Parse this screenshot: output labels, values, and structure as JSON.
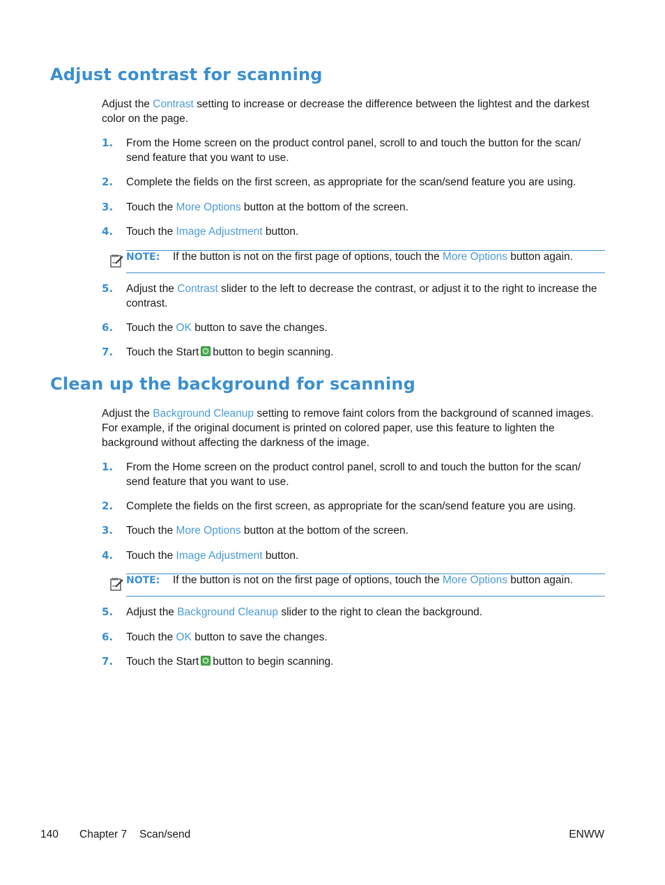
{
  "section1": {
    "title": "Adjust contrast for scanning",
    "intro": {
      "pre": "Adjust the ",
      "link": "Contrast",
      "post": " setting to increase or decrease the difference between the lightest and the darkest color on the page."
    },
    "steps": [
      {
        "num": "1.",
        "text": "From the Home screen on the product control panel, scroll to and touch the button for the scan/ send feature that you want to use."
      },
      {
        "num": "2.",
        "text": "Complete the fields on the first screen, as appropriate for the scan/send feature you are using."
      },
      {
        "num": "3.",
        "pre": "Touch the ",
        "link": "More Options",
        "post": " button at the bottom of the screen."
      },
      {
        "num": "4.",
        "pre": "Touch the ",
        "link": "Image Adjustment",
        "post": " button."
      },
      {
        "num": "5.",
        "pre": "Adjust the ",
        "link": "Contrast",
        "post": " slider to the left to decrease the contrast, or adjust it to the right to increase the contrast."
      },
      {
        "num": "6.",
        "pre": "Touch the ",
        "link": "OK",
        "post": " button to save the changes."
      },
      {
        "num": "7.",
        "pre": "Touch the Start",
        "post": "button to begin scanning."
      }
    ],
    "note": {
      "label": "NOTE:",
      "pre": "If the button is not on the first page of options, touch the ",
      "link": "More Options",
      "post": " button again."
    }
  },
  "section2": {
    "title": "Clean up the background for scanning",
    "intro": {
      "pre": "Adjust the ",
      "link": "Background Cleanup",
      "post": " setting to remove faint colors from the background of scanned images. For example, if the original document is printed on colored paper, use this feature to lighten the background without affecting the darkness of the image."
    },
    "steps": [
      {
        "num": "1.",
        "text": "From the Home screen on the product control panel, scroll to and touch the button for the scan/ send feature that you want to use."
      },
      {
        "num": "2.",
        "text": "Complete the fields on the first screen, as appropriate for the scan/send feature you are using."
      },
      {
        "num": "3.",
        "pre": "Touch the ",
        "link": "More Options",
        "post": " button at the bottom of the screen."
      },
      {
        "num": "4.",
        "pre": "Touch the ",
        "link": "Image Adjustment",
        "post": " button."
      },
      {
        "num": "5.",
        "pre": "Adjust the ",
        "link": "Background Cleanup",
        "post": " slider to the right to clean the background."
      },
      {
        "num": "6.",
        "pre": "Touch the ",
        "link": "OK",
        "post": " button to save the changes."
      },
      {
        "num": "7.",
        "pre": "Touch the Start",
        "post": "button to begin scanning."
      }
    ],
    "note": {
      "label": "NOTE:",
      "pre": "If the button is not on the first page of options, touch the ",
      "link": "More Options",
      "post": " button again."
    }
  },
  "footer": {
    "page_number": "140",
    "chapter": "Chapter 7",
    "chapter_title": "Scan/send",
    "locale": "ENWW"
  }
}
